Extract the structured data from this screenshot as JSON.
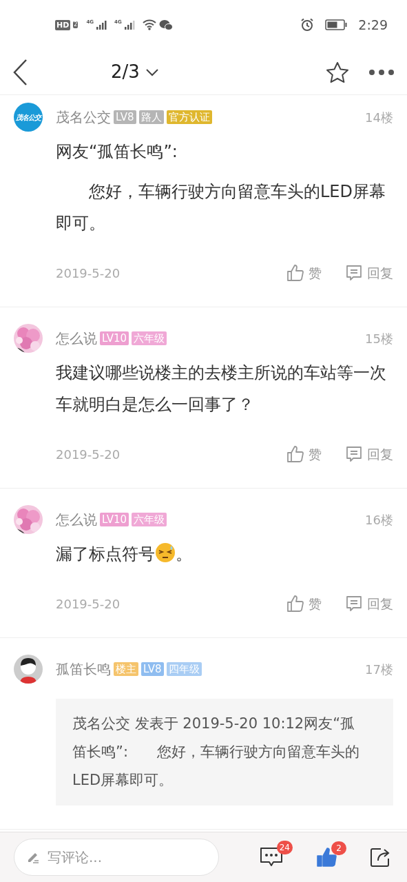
{
  "status_bar": {
    "hd": "HD",
    "sim": "2",
    "networks": [
      "4G",
      "4G"
    ],
    "time": "2:29"
  },
  "header": {
    "page": "2/3"
  },
  "posts": [
    {
      "author": "茂名公交",
      "avatar": {
        "kind": "logo",
        "text": "茂名公交"
      },
      "badges": [
        {
          "text": "LV8",
          "color": "#b5b5b5"
        },
        {
          "text": "路人",
          "color": "#b5b5b5"
        },
        {
          "text": "官方认证",
          "color": "#dfb72e"
        }
      ],
      "floor": "14楼",
      "paragraphs": [
        [
          {
            "kind": "text",
            "text": "网友“孤笛长鸣”:"
          }
        ],
        [
          {
            "kind": "text",
            "text": "　　您好，车辆行驶方向留意车头的LED屏幕即可。"
          }
        ]
      ],
      "date": "2019-5-20",
      "like": "赞",
      "reply": "回复"
    },
    {
      "author": "怎么说",
      "avatar": {
        "kind": "picture"
      },
      "badges": [
        {
          "text": "LV10",
          "color": "#ee9fd0"
        },
        {
          "text": "六年级",
          "color": "#f0a8d6"
        }
      ],
      "floor": "15楼",
      "paragraphs": [
        [
          {
            "kind": "text",
            "text": "我建议哪些说楼主的去楼主所说的车站等一次车就明白是怎么一回事了？"
          }
        ]
      ],
      "date": "2019-5-20",
      "like": "赞",
      "reply": "回复"
    },
    {
      "author": "怎么说",
      "avatar": {
        "kind": "picture"
      },
      "badges": [
        {
          "text": "LV10",
          "color": "#ee9fd0"
        },
        {
          "text": "六年级",
          "color": "#f0a8d6"
        }
      ],
      "floor": "16楼",
      "paragraphs": [
        [
          {
            "kind": "text",
            "text": "漏了标点符号"
          },
          {
            "kind": "emoji"
          },
          {
            "kind": "text",
            "text": "。"
          }
        ]
      ],
      "date": "2019-5-20",
      "like": "赞",
      "reply": "回复"
    },
    {
      "author": "孤笛长鸣",
      "avatar": {
        "kind": "cartoon"
      },
      "badges": [
        {
          "text": "楼主",
          "color": "#f5c46c"
        },
        {
          "text": "LV8",
          "color": "#8fbdf0"
        },
        {
          "text": "四年级",
          "color": "#a9cdf4"
        }
      ],
      "floor": "17楼",
      "quote": "茂名公交 发表于 2019-5-20 10:12网友“孤笛长鸣”:　　您好，车辆行驶方向留意车头的LED屏幕即可。"
    }
  ],
  "bottom_bar": {
    "placeholder": "写评论...",
    "comment_count": "24",
    "like_count": "2",
    "liked": true
  }
}
